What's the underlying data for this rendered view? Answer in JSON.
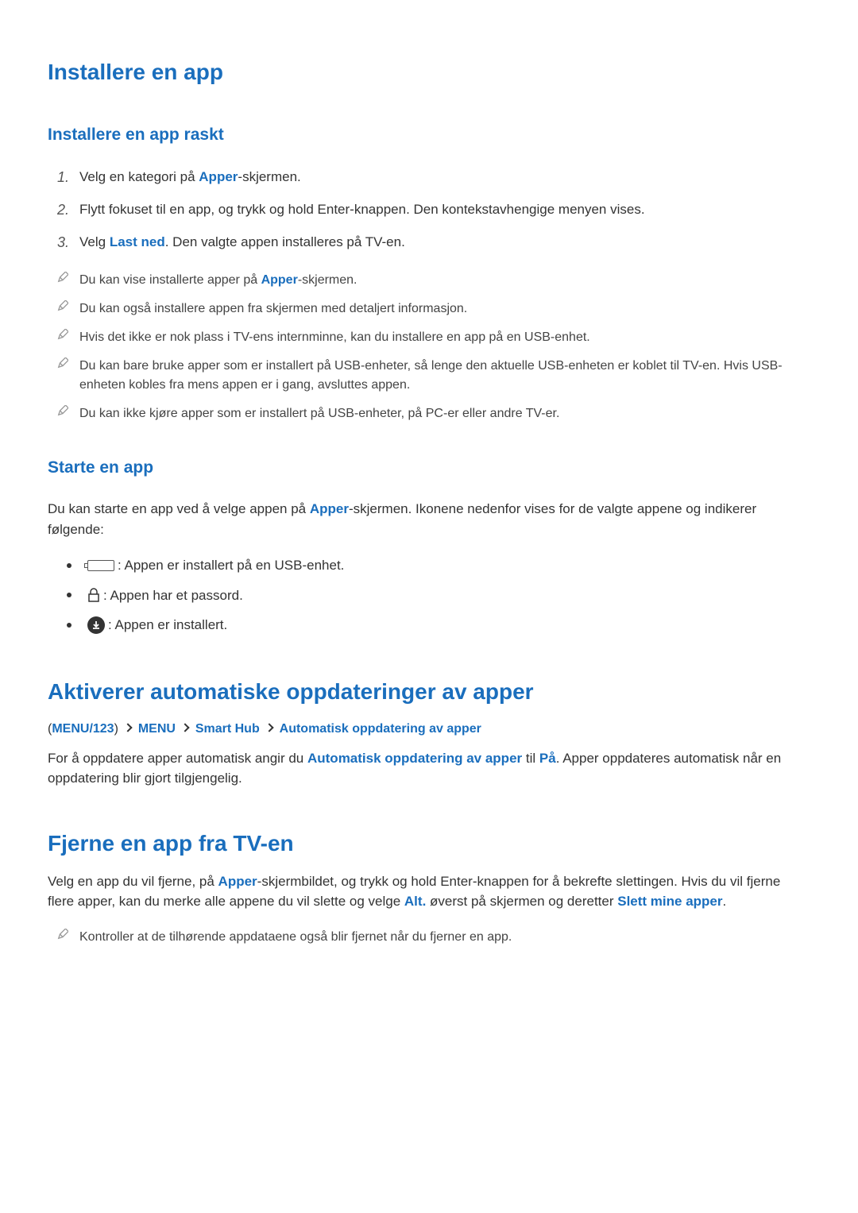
{
  "headings": {
    "h1_install": "Installere en app",
    "h2_install_quick": "Installere en app raskt",
    "h2_start_app": "Starte en app",
    "h1_auto_update": "Aktiverer automatiske oppdateringer av apper",
    "h1_remove": "Fjerne en app fra TV-en"
  },
  "steps": {
    "s1_a": "Velg en kategori på ",
    "s1_b": "Apper",
    "s1_c": "-skjermen.",
    "s2": "Flytt fokuset til en app, og trykk og hold Enter-knappen. Den kontekstavhengige menyen vises.",
    "s3_a": "Velg ",
    "s3_b": "Last ned",
    "s3_c": ". Den valgte appen installeres på TV-en."
  },
  "notes": {
    "n1_a": "Du kan vise installerte apper på ",
    "n1_b": "Apper",
    "n1_c": "-skjermen.",
    "n2": "Du kan også installere appen fra skjermen med detaljert informasjon.",
    "n3": "Hvis det ikke er nok plass i TV-ens internminne, kan du installere en app på en USB-enhet.",
    "n4": "Du kan bare bruke apper som er installert på USB-enheter, så lenge den aktuelle USB-enheten er koblet til TV-en. Hvis USB-enheten kobles fra mens appen er i gang, avsluttes appen.",
    "n5": "Du kan ikke kjøre apper som er installert på USB-enheter, på PC-er eller andre TV-er."
  },
  "start_app": {
    "intro_a": "Du kan starte en app ved å velge appen på ",
    "intro_b": "Apper",
    "intro_c": "-skjermen. Ikonene nedenfor vises for de valgte appene og indikerer følgende:",
    "usb": ": Appen er installert på en USB-enhet.",
    "lock": " : Appen har et passord.",
    "installed": " : Appen er installert."
  },
  "breadcrumb": {
    "paren_open": "(",
    "b1": "MENU/123",
    "paren_close": ") ",
    "b2": "MENU",
    "b3": "Smart Hub",
    "b4": "Automatisk oppdatering av apper"
  },
  "auto_update_para": {
    "a": "For å oppdatere apper automatisk angir du ",
    "b": "Automatisk oppdatering av apper",
    "c": " til ",
    "d": "På",
    "e": ". Apper oppdateres automatisk når en oppdatering blir gjort tilgjengelig."
  },
  "remove_para": {
    "a": "Velg en app du vil fjerne, på ",
    "b": "Apper",
    "c": "-skjermbildet, og trykk og hold Enter-knappen for å bekrefte slettingen. Hvis du vil fjerne flere apper, kan du merke alle appene du vil slette og velge ",
    "d": "Alt.",
    "e": " øverst på skjermen og deretter ",
    "f": "Slett mine apper",
    "g": "."
  },
  "remove_note": "Kontroller at de tilhørende appdataene også blir fjernet når du fjerner en app."
}
